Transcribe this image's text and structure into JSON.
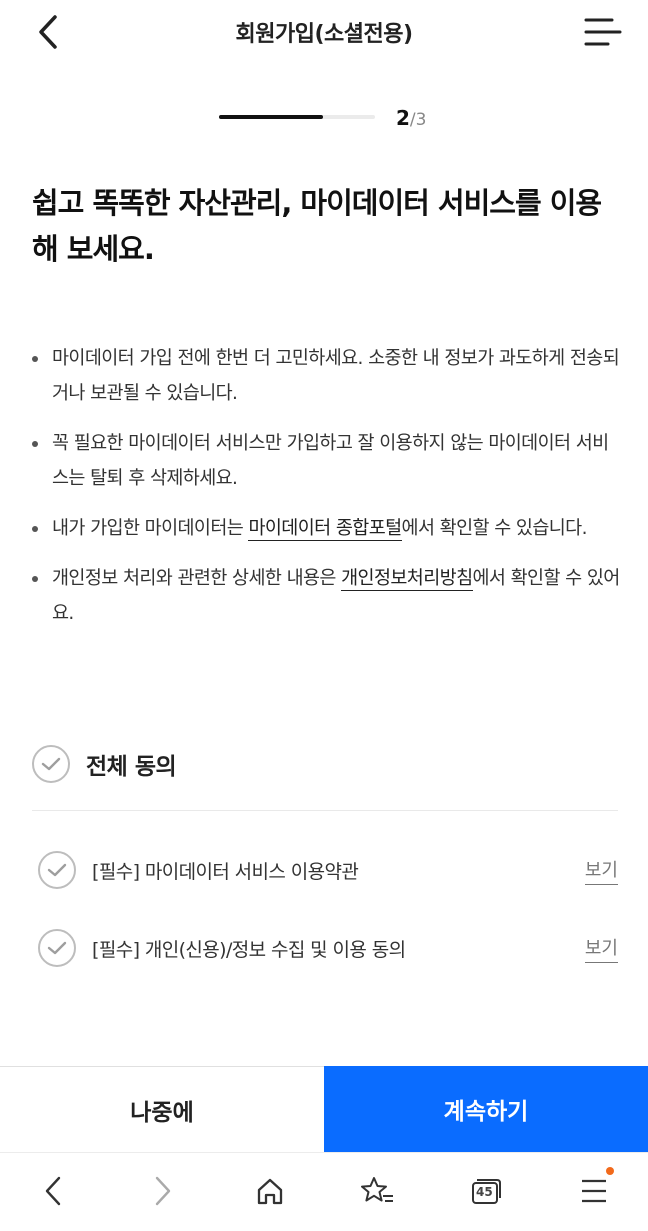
{
  "header": {
    "title": "회원가입(소셜전용)",
    "back_icon": "chevron-left-icon",
    "menu_icon": "hamburger-menu-icon"
  },
  "progress": {
    "current": "2",
    "separator": "/",
    "total": "3",
    "fraction": 0.667
  },
  "headline": "쉽고 똑똑한 자산관리, 마이데이터 서비스를 이용해 보세요.",
  "notices": [
    {
      "text": "마이데이터 가입 전에 한번 더 고민하세요. 소중한 내 정보가 과도하게 전송되거나 보관될 수 있습니다."
    },
    {
      "text": "꼭 필요한 마이데이터 서비스만 가입하고 잘 이용하지 않는 마이데이터 서비스는 탈퇴 후 삭제하세요."
    },
    {
      "before": "내가 가입한 마이데이터는 ",
      "link": "마이데이터 종합포털",
      "after": "에서 확인할 수 있습니다."
    },
    {
      "before": "개인정보 처리와 관련한 상세한 내용은 ",
      "link": "개인정보처리방침",
      "after": "에서 확인할 수 있어요."
    }
  ],
  "agree_all": {
    "label": "전체 동의",
    "checked": false
  },
  "terms": [
    {
      "label": "[필수] 마이데이터 서비스 이용약관",
      "view": "보기",
      "checked": false
    },
    {
      "label": "[필수] 개인(신용)/정보 수집 및 이용 동의",
      "view": "보기",
      "checked": false
    }
  ],
  "buttons": {
    "later": "나중에",
    "continue": "계속하기"
  },
  "browser_bar": {
    "tabs_count": "45",
    "colors": {
      "accent": "#0a6cff",
      "notification": "#f26a1b"
    }
  }
}
